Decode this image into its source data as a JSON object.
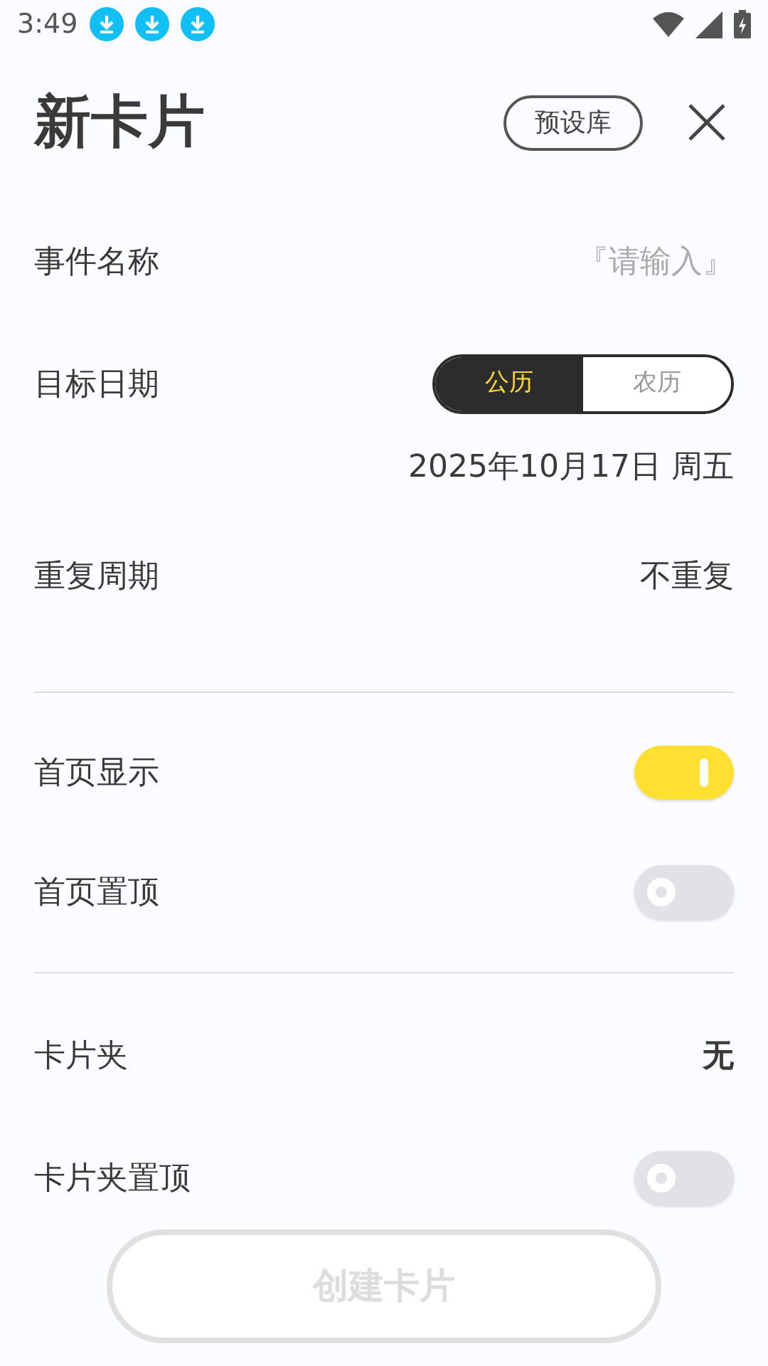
{
  "status_bar": {
    "time": "3:49"
  },
  "header": {
    "title": "新卡片",
    "preset_button": "预设库"
  },
  "fields": [
    {
      "kind": "text",
      "label": "事件名称",
      "placeholder": "『请输入』"
    },
    {
      "kind": "calendar",
      "label": "目标日期",
      "options": [
        {
          "label": "公历",
          "selected": true
        },
        {
          "label": "农历",
          "selected": false
        }
      ],
      "value": "2025年10月17日 周五"
    },
    {
      "kind": "select",
      "label": "重复周期",
      "value": "不重复",
      "bold": false
    },
    {
      "kind": "divider"
    },
    {
      "kind": "switch",
      "label": "首页显示",
      "on": true
    },
    {
      "kind": "switch",
      "label": "首页置顶",
      "on": false
    },
    {
      "kind": "divider"
    },
    {
      "kind": "select",
      "label": "卡片夹",
      "value": "无",
      "bold": true
    },
    {
      "kind": "switch",
      "label": "卡片夹置顶",
      "on": false
    }
  ],
  "create_button": {
    "label": "创建卡片",
    "disabled": true
  }
}
